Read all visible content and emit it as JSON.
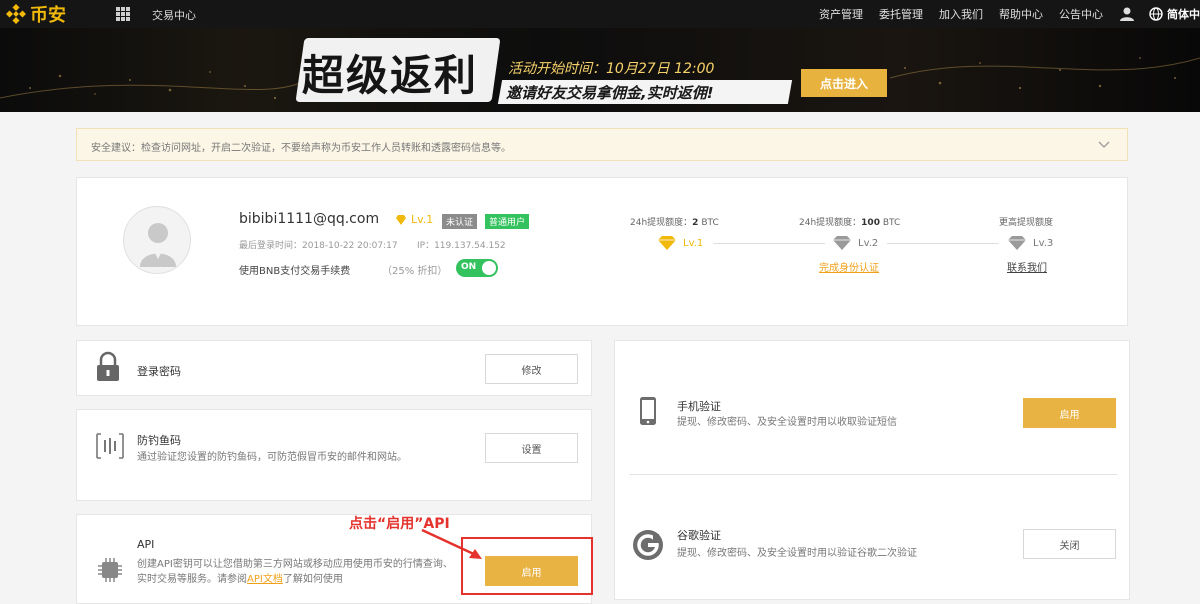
{
  "nav": {
    "logo_text": "币安",
    "trade_center": "交易中心",
    "links": [
      "资产管理",
      "委托管理",
      "加入我们",
      "帮助中心",
      "公告中心"
    ],
    "language": "简体中"
  },
  "banner": {
    "title": "超级返利",
    "start_time": "活动开始时间：10月27日 12:00",
    "subtitle": "邀请好友交易拿佣金,实时返佣!",
    "button": "点击进入"
  },
  "notice": {
    "text": "安全建议：检查访问网址，开启二次验证，不要给声称为币安工作人员转账和透露密码信息等。"
  },
  "profile": {
    "email": "bibibi1111@qq.com",
    "level": "Lv.1",
    "badge_unverified": "未认证",
    "badge_normal": "普通用户",
    "last_login": "最后登录时间：2018-10-22 20:07:17",
    "ip": "IP：119.137.54.152",
    "bnb_fee": "使用BNB支付交易手续费",
    "bnb_rate": "（25% 折扣）",
    "bnb_toggle": "ON"
  },
  "limits": [
    {
      "label": "24h提现额度：",
      "amount": "2",
      "unit": "BTC",
      "level": "Lv.1"
    },
    {
      "label": "24h提现额度：",
      "amount": "100",
      "unit": "BTC",
      "level": "Lv.2",
      "link": "完成身份认证"
    },
    {
      "label": "更高提现额度",
      "amount": "",
      "unit": "",
      "level": "Lv.3",
      "link": "联系我们"
    }
  ],
  "security_left": {
    "login_password": {
      "title": "登录密码",
      "button": "修改"
    },
    "anti_phishing": {
      "title": "防钓鱼码",
      "desc": "通过验证您设置的防钓鱼码，可防范假冒币安的邮件和网站。",
      "button": "设置"
    },
    "api": {
      "title": "API",
      "desc_1": "创建API密钥可以让您借助第三方网站或移动应用使用币安的行情查询、实时交易等服务。请参阅",
      "link": "API文档",
      "desc_2": "了解如何使用",
      "button": "启用"
    }
  },
  "security_right": {
    "sms": {
      "title": "手机验证",
      "desc": "提现、修改密码、及安全设置时用以收取验证短信",
      "button": "启用"
    },
    "google": {
      "title": "谷歌验证",
      "desc": "提现、修改密码、及安全设置时用以验证谷歌二次验证",
      "button": "关闭"
    }
  },
  "annotation": {
    "text": "点击“启用”API"
  },
  "colors": {
    "brand": "#f0b90b",
    "gold_button": "#e8b342",
    "toggle_on": "#33c25e",
    "annotation": "#e5322d"
  }
}
